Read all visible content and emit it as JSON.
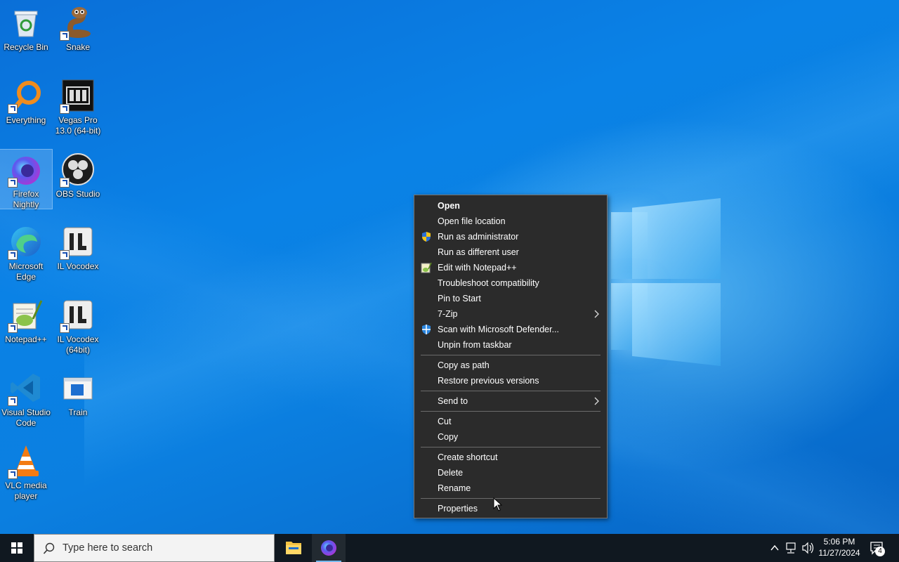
{
  "desktop": {
    "icons": [
      {
        "label": "Recycle Bin",
        "icon": "recycle-bin-icon"
      },
      {
        "label": "Snake",
        "icon": "snake-icon"
      },
      {
        "label": "Everything",
        "icon": "everything-search-icon"
      },
      {
        "label": "Vegas Pro 13.0 (64-bit)",
        "icon": "vegas-pro-icon"
      },
      {
        "label": "Firefox Nightly",
        "icon": "firefox-nightly-icon"
      },
      {
        "label": "OBS Studio",
        "icon": "obs-studio-icon"
      },
      {
        "label": "Microsoft Edge",
        "icon": "edge-icon"
      },
      {
        "label": "IL Vocodex",
        "icon": "il-vocodex-icon"
      },
      {
        "label": "Notepad++",
        "icon": "notepad-plus-plus-icon"
      },
      {
        "label": "IL Vocodex (64bit)",
        "icon": "il-vocodex-64-icon"
      },
      {
        "label": "Visual Studio Code",
        "icon": "vscode-icon"
      },
      {
        "label": "Train",
        "icon": "train-icon"
      },
      {
        "label": "VLC media player",
        "icon": "vlc-icon"
      }
    ]
  },
  "context_menu": {
    "groups": [
      [
        {
          "label": "Open",
          "bold": true
        },
        {
          "label": "Open file location"
        },
        {
          "label": "Run as administrator",
          "icon": "uac-shield-icon"
        },
        {
          "label": "Run as different user"
        },
        {
          "label": "Edit with Notepad++",
          "icon": "notepad-plus-plus-icon"
        },
        {
          "label": "Troubleshoot compatibility"
        },
        {
          "label": "Pin to Start"
        },
        {
          "label": "7-Zip",
          "submenu": true
        },
        {
          "label": "Scan with Microsoft Defender...",
          "icon": "defender-icon"
        },
        {
          "label": "Unpin from taskbar"
        }
      ],
      [
        {
          "label": "Copy as path"
        },
        {
          "label": "Restore previous versions"
        }
      ],
      [
        {
          "label": "Send to",
          "submenu": true
        }
      ],
      [
        {
          "label": "Cut"
        },
        {
          "label": "Copy"
        }
      ],
      [
        {
          "label": "Create shortcut"
        },
        {
          "label": "Delete"
        },
        {
          "label": "Rename"
        }
      ],
      [
        {
          "label": "Properties"
        }
      ]
    ],
    "submenu_arrow": ">"
  },
  "taskbar": {
    "search_placeholder": "Type here to search",
    "pinned": [
      {
        "name": "File Explorer",
        "icon": "file-explorer-icon"
      },
      {
        "name": "Firefox Nightly",
        "icon": "firefox-nightly-icon",
        "active": true
      }
    ],
    "clock_time": "5:06 PM",
    "clock_date": "11/27/2024",
    "notification_count": "4"
  },
  "colors": {
    "menu_bg": "#2b2b2b",
    "taskbar_bg": "#101820",
    "wallpaper_blue": "#0a82e6"
  }
}
